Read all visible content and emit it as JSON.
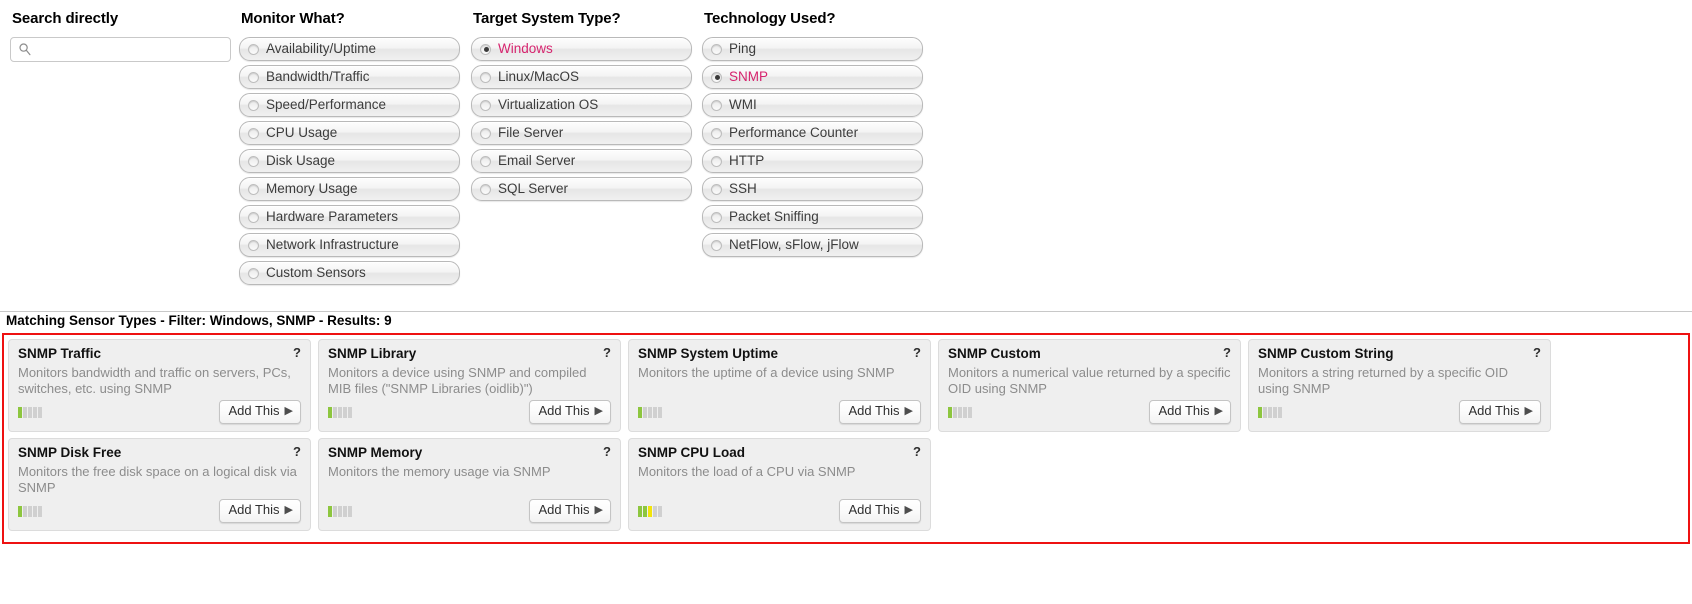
{
  "colors": {
    "accent_selected": "#d6246e",
    "results_border": "#ee1111",
    "rating_green": "#8dc63f",
    "rating_yellow": "#f2e40a",
    "rating_empty": "#d0d0d0"
  },
  "search": {
    "heading": "Search directly",
    "placeholder": "",
    "value": "",
    "icon": "search-icon"
  },
  "filters": [
    {
      "key": "monitor_what",
      "heading": "Monitor What?",
      "options": [
        {
          "label": "Availability/Uptime",
          "selected": false
        },
        {
          "label": "Bandwidth/Traffic",
          "selected": false
        },
        {
          "label": "Speed/Performance",
          "selected": false
        },
        {
          "label": "CPU Usage",
          "selected": false
        },
        {
          "label": "Disk Usage",
          "selected": false
        },
        {
          "label": "Memory Usage",
          "selected": false
        },
        {
          "label": "Hardware Parameters",
          "selected": false
        },
        {
          "label": "Network Infrastructure",
          "selected": false
        },
        {
          "label": "Custom Sensors",
          "selected": false
        }
      ]
    },
    {
      "key": "target_system_type",
      "heading": "Target System Type?",
      "options": [
        {
          "label": "Windows",
          "selected": true
        },
        {
          "label": "Linux/MacOS",
          "selected": false
        },
        {
          "label": "Virtualization OS",
          "selected": false
        },
        {
          "label": "File Server",
          "selected": false
        },
        {
          "label": "Email Server",
          "selected": false
        },
        {
          "label": "SQL Server",
          "selected": false
        }
      ]
    },
    {
      "key": "technology_used",
      "heading": "Technology Used?",
      "options": [
        {
          "label": "Ping",
          "selected": false
        },
        {
          "label": "SNMP",
          "selected": true
        },
        {
          "label": "WMI",
          "selected": false
        },
        {
          "label": "Performance Counter",
          "selected": false
        },
        {
          "label": "HTTP",
          "selected": false
        },
        {
          "label": "SSH",
          "selected": false
        },
        {
          "label": "Packet Sniffing",
          "selected": false
        },
        {
          "label": "NetFlow, sFlow, jFlow",
          "selected": false
        }
      ]
    }
  ],
  "results": {
    "heading": "Matching Sensor Types - Filter: Windows, SNMP - Results: 9",
    "add_button_label": "Add This",
    "add_button_arrow": "▶",
    "help_glyph": "?",
    "cards": [
      {
        "title": "SNMP Traffic",
        "description": "Monitors bandwidth and traffic on servers, PCs, switches, etc. using SNMP",
        "rating": [
          "g",
          "e",
          "e",
          "e",
          "e"
        ]
      },
      {
        "title": "SNMP Library",
        "description": "Monitors a device using SNMP and compiled MIB files (\"SNMP Libraries (oidlib)\")",
        "rating": [
          "g",
          "e",
          "e",
          "e",
          "e"
        ]
      },
      {
        "title": "SNMP System Uptime",
        "description": "Monitors the uptime of a device using SNMP",
        "rating": [
          "g",
          "e",
          "e",
          "e",
          "e"
        ]
      },
      {
        "title": "SNMP Custom",
        "description": "Monitors a numerical value returned by a specific OID using SNMP",
        "rating": [
          "g",
          "e",
          "e",
          "e",
          "e"
        ]
      },
      {
        "title": "SNMP Custom String",
        "description": "Monitors a string returned by a specific OID using SNMP",
        "rating": [
          "g",
          "e",
          "e",
          "e",
          "e"
        ]
      },
      {
        "title": "SNMP Disk Free",
        "description": "Monitors the free disk space on a logical disk via SNMP",
        "rating": [
          "g",
          "e",
          "e",
          "e",
          "e"
        ]
      },
      {
        "title": "SNMP Memory",
        "description": "Monitors the memory usage via SNMP",
        "rating": [
          "g",
          "e",
          "e",
          "e",
          "e"
        ]
      },
      {
        "title": "SNMP CPU Load",
        "description": "Monitors the load of a CPU via SNMP",
        "rating": [
          "g",
          "g",
          "y",
          "e",
          "e"
        ]
      }
    ]
  }
}
